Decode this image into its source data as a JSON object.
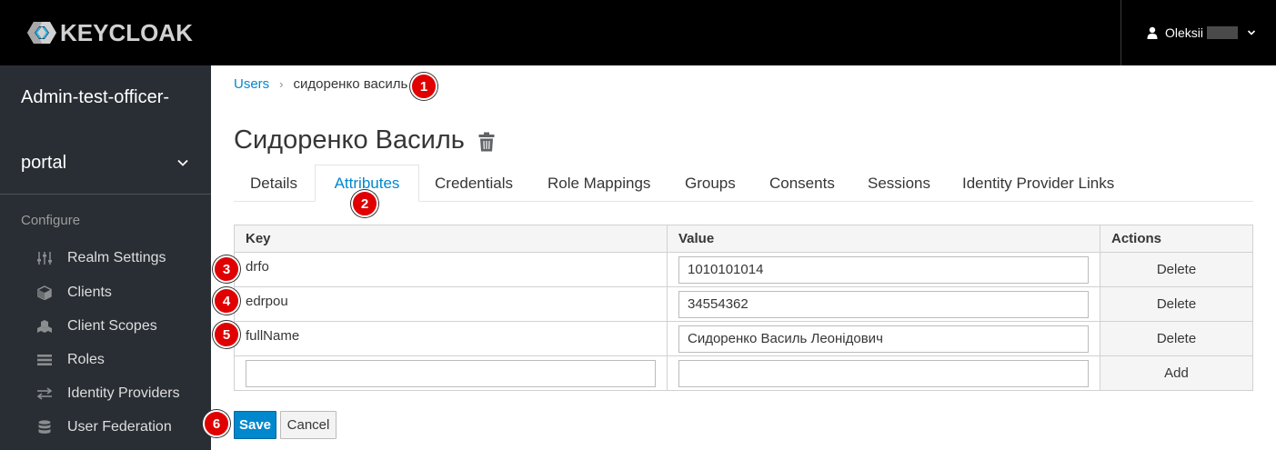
{
  "header": {
    "logo_text": "KEYCLOAK",
    "user_name": "Oleksii"
  },
  "sidebar": {
    "realm_line1": "Admin-test-officer-",
    "realm_line2": "portal",
    "section_label": "Configure",
    "items": [
      {
        "label": "Realm Settings",
        "icon": "sliders-icon"
      },
      {
        "label": "Clients",
        "icon": "cube-icon"
      },
      {
        "label": "Client Scopes",
        "icon": "cubes-icon"
      },
      {
        "label": "Roles",
        "icon": "list-icon"
      },
      {
        "label": "Identity Providers",
        "icon": "exchange-icon"
      },
      {
        "label": "User Federation",
        "icon": "database-icon"
      }
    ]
  },
  "breadcrumb": {
    "parent": "Users",
    "current": "сидоренко василь"
  },
  "page": {
    "title": "Сидоренко Василь"
  },
  "tabs": [
    {
      "label": "Details"
    },
    {
      "label": "Attributes"
    },
    {
      "label": "Credentials"
    },
    {
      "label": "Role Mappings"
    },
    {
      "label": "Groups"
    },
    {
      "label": "Consents"
    },
    {
      "label": "Sessions"
    },
    {
      "label": "Identity Provider Links"
    }
  ],
  "table": {
    "headers": {
      "key": "Key",
      "value": "Value",
      "actions": "Actions"
    },
    "rows": [
      {
        "key": "drfo",
        "value": "1010101014",
        "action": "Delete"
      },
      {
        "key": "edrpou",
        "value": "34554362",
        "action": "Delete"
      },
      {
        "key": "fullName",
        "value": "Сидоренко Василь Леонідович",
        "action": "Delete"
      }
    ],
    "new_row": {
      "key": "",
      "value": "",
      "action": "Add"
    }
  },
  "buttons": {
    "save": "Save",
    "cancel": "Cancel"
  },
  "callouts": [
    "1",
    "2",
    "3",
    "4",
    "5",
    "6"
  ],
  "colors": {
    "accent": "#0088ce",
    "callout": "#e00000",
    "sidebar_bg": "#292e34",
    "header_bg": "#000000"
  }
}
